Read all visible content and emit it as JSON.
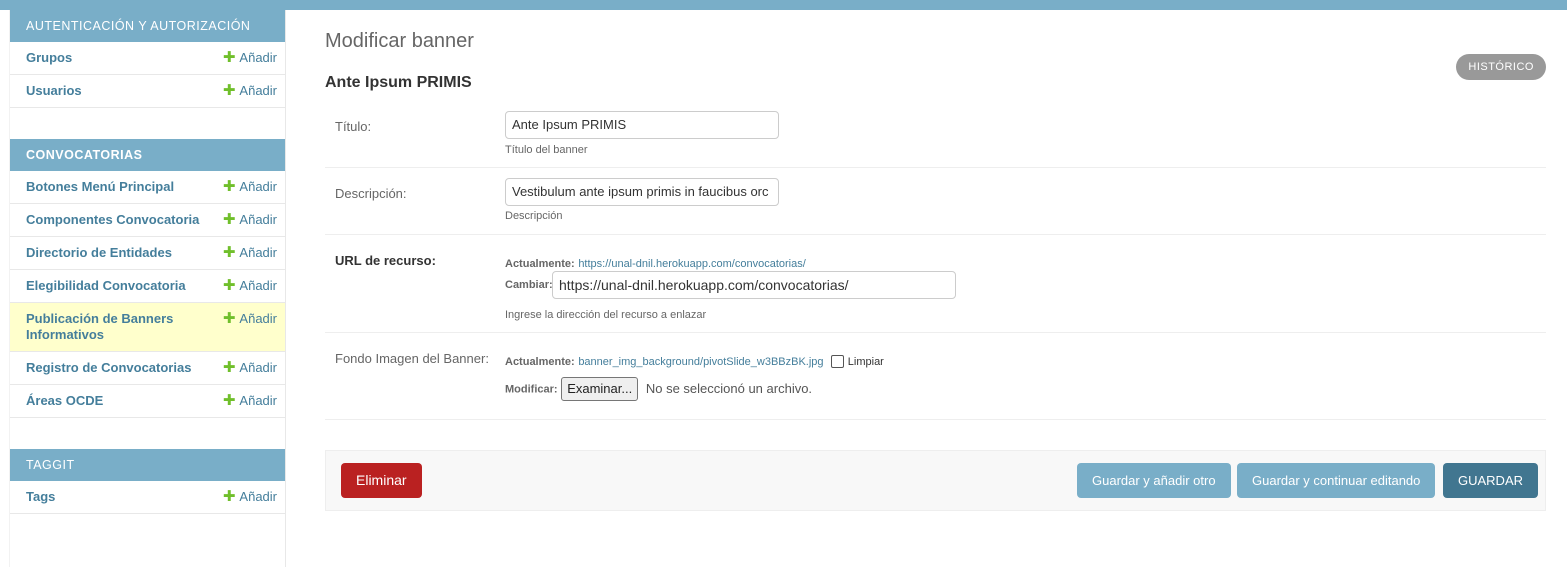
{
  "sidebar": {
    "add_label": "Añadir",
    "modules": [
      {
        "title": "AUTENTICACIÓN Y AUTORIZACIÓN",
        "models": [
          "Grupos",
          "Usuarios"
        ]
      },
      {
        "title": "CONVOCATORIAS",
        "models": [
          "Botones Menú Principal",
          "Componentes Convocatoria",
          "Directorio de Entidades",
          "Elegibilidad Convocatoria",
          "Publicación de Banners Informativos",
          "Registro de Convocatorias",
          "Áreas OCDE"
        ]
      },
      {
        "title": "TAGGIT",
        "models": [
          "Tags"
        ]
      }
    ]
  },
  "page": {
    "title": "Modificar banner",
    "object_title": "Ante Ipsum PRIMIS",
    "history_label": "HISTÓRICO"
  },
  "form": {
    "titulo": {
      "label": "Título:",
      "value": "Ante Ipsum PRIMIS",
      "help": "Título del banner"
    },
    "descripcion": {
      "label": "Descripción:",
      "value": "Vestibulum ante ipsum primis in faucibus orc",
      "help": "Descripción"
    },
    "url": {
      "label": "URL de recurso:",
      "current_label": "Actualmente:",
      "current_value": "https://unal-dnil.herokuapp.com/convocatorias/",
      "change_label": "Cambiar:",
      "value": "https://unal-dnil.herokuapp.com/convocatorias/",
      "help": "Ingrese la dirección del recurso a enlazar"
    },
    "imagen": {
      "label": "Fondo Imagen del Banner:",
      "current_label": "Actualmente:",
      "current_value": "banner_img_background/pivotSlide_w3BBzBK.jpg",
      "clear_label": "Limpiar",
      "modify_label": "Modificar:",
      "browse_label": "Examinar...",
      "no_file": "No se seleccionó un archivo."
    }
  },
  "submit": {
    "delete": "Eliminar",
    "save_add": "Guardar y añadir otro",
    "save_continue": "Guardar y continuar editando",
    "save": "GUARDAR"
  },
  "colors": {
    "header": "#79aec8",
    "link": "#447e9b",
    "add_plus": "#70bf2b",
    "delete": "#ba2121",
    "save_default": "#417690",
    "highlight_row": "#ffffcc"
  }
}
